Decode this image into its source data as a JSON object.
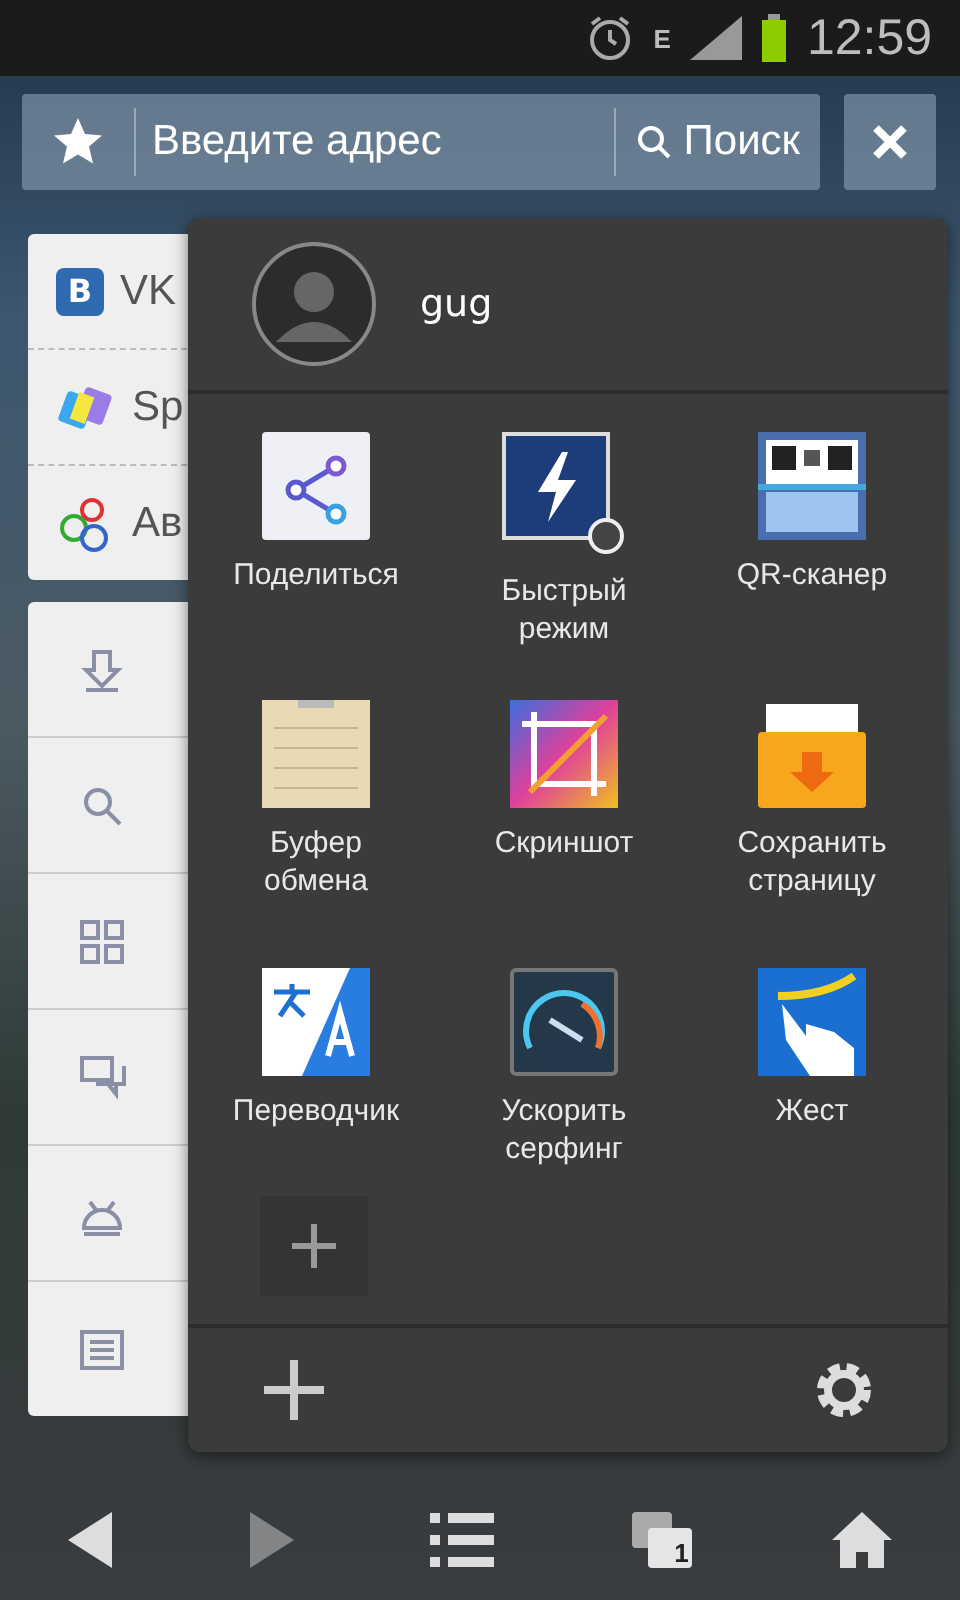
{
  "status_bar": {
    "network": "E",
    "time": "12:59"
  },
  "address_bar": {
    "placeholder": "Введите адрес",
    "search_label": "Поиск"
  },
  "bookmarks": [
    {
      "kind": "vk",
      "name": "VK",
      "logo": "B"
    },
    {
      "kind": "spaces",
      "name": "Sp"
    },
    {
      "kind": "avito",
      "name": "Ав"
    }
  ],
  "menu": [
    {
      "kind": "download"
    },
    {
      "kind": "search"
    },
    {
      "kind": "grid"
    },
    {
      "kind": "chat"
    },
    {
      "kind": "android"
    },
    {
      "kind": "news"
    }
  ],
  "panel": {
    "user": "gug",
    "tools": [
      {
        "kind": "share",
        "label": "Поделиться"
      },
      {
        "kind": "fast",
        "label": "Быстрый\nрежим"
      },
      {
        "kind": "qr",
        "label": "QR-сканер"
      },
      {
        "kind": "clipboard",
        "label": "Буфер\nобмена"
      },
      {
        "kind": "screenshot",
        "label": "Скриншот"
      },
      {
        "kind": "save",
        "label": "Сохранить\nстраницу"
      },
      {
        "kind": "translate",
        "label": "Переводчик"
      },
      {
        "kind": "speed",
        "label": "Ускорить\nсерфинг"
      },
      {
        "kind": "gesture",
        "label": "Жест"
      }
    ]
  },
  "nav": [
    {
      "kind": "back",
      "disabled": false
    },
    {
      "kind": "forward",
      "disabled": true
    },
    {
      "kind": "menu",
      "disabled": false
    },
    {
      "kind": "tabs",
      "disabled": false,
      "count": "1"
    },
    {
      "kind": "home",
      "disabled": false
    }
  ]
}
